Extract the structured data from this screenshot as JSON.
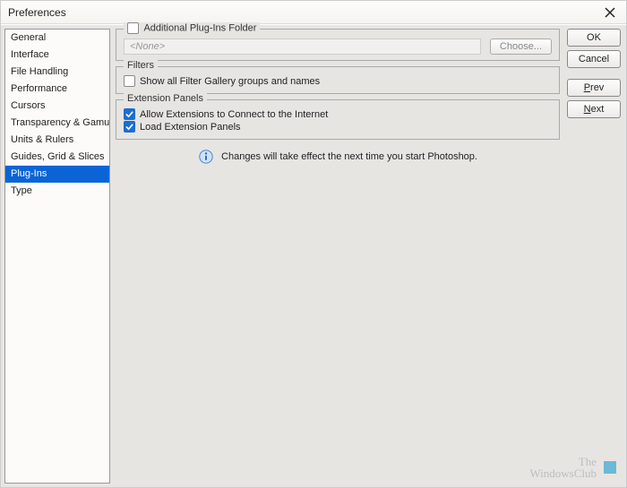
{
  "window": {
    "title": "Preferences"
  },
  "sidebar": {
    "items": [
      {
        "label": "General"
      },
      {
        "label": "Interface"
      },
      {
        "label": "File Handling"
      },
      {
        "label": "Performance"
      },
      {
        "label": "Cursors"
      },
      {
        "label": "Transparency & Gamut"
      },
      {
        "label": "Units & Rulers"
      },
      {
        "label": "Guides, Grid & Slices"
      },
      {
        "label": "Plug-Ins"
      },
      {
        "label": "Type"
      }
    ],
    "active_index": 8
  },
  "groups": {
    "additional": {
      "legend": "Additional Plug-Ins Folder",
      "checked": false,
      "placeholder": "<None>",
      "choose_label": "Choose..."
    },
    "filters": {
      "legend": "Filters",
      "show_all": {
        "label": "Show all Filter Gallery groups and names",
        "checked": false
      }
    },
    "extension": {
      "legend": "Extension Panels",
      "allow": {
        "label": "Allow Extensions to Connect to the Internet",
        "checked": true
      },
      "load": {
        "label": "Load Extension Panels",
        "checked": true
      }
    }
  },
  "info": {
    "text": "Changes will take effect the next time you start Photoshop."
  },
  "buttons": {
    "ok": "OK",
    "cancel": "Cancel",
    "prev": "Prev",
    "next": "Next"
  },
  "watermark": {
    "line1": "The",
    "line2": "WindowsClub"
  }
}
